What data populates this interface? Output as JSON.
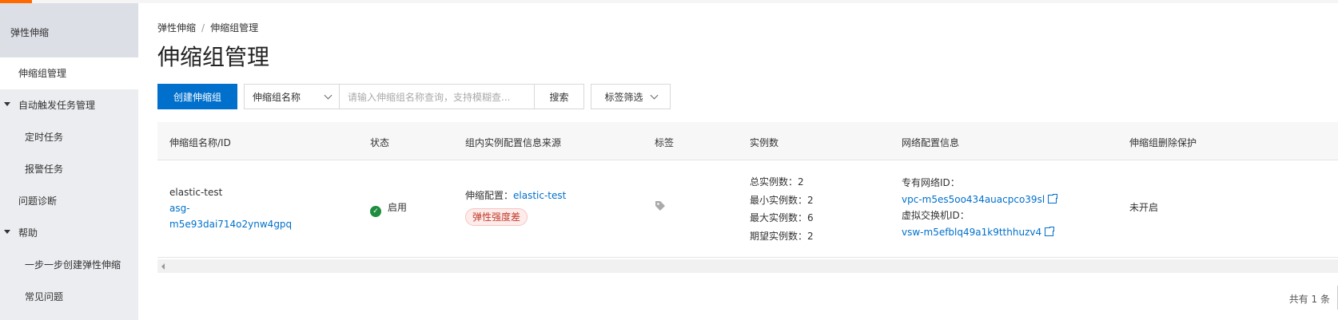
{
  "sidebar": {
    "title": "弹性伸缩",
    "items": [
      {
        "label": "伸缩组管理"
      },
      {
        "label": "自动触发任务管理"
      },
      {
        "label": "定时任务"
      },
      {
        "label": "报警任务"
      },
      {
        "label": "问题诊断"
      },
      {
        "label": "帮助"
      },
      {
        "label": "一步一步创建弹性伸缩"
      },
      {
        "label": "常见问题"
      }
    ]
  },
  "breadcrumb": {
    "root": "弹性伸缩",
    "separator": "/",
    "current": "伸缩组管理"
  },
  "page_title": "伸缩组管理",
  "toolbar": {
    "create_label": "创建伸缩组",
    "filter_select": "伸缩组名称",
    "search_placeholder": "请输入伸缩组名称查询，支持模糊查...",
    "search_label": "搜索",
    "tag_filter_label": "标签筛选"
  },
  "table": {
    "headers": [
      "伸缩组名称/ID",
      "状态",
      "组内实例配置信息来源",
      "标签",
      "实例数",
      "网络配置信息",
      "伸缩组删除保护"
    ],
    "rows": [
      {
        "name": "elastic-test",
        "id_line1": "asg-",
        "id_line2": "m5e93dai714o2ynw4gpq",
        "status": "启用",
        "config_label": "伸缩配置：",
        "config_value": "elastic-test",
        "badge": "弹性强度差",
        "counts": [
          "总实例数：2",
          "最小实例数：2",
          "最大实例数：6",
          "期望实例数：2"
        ],
        "vpc_label": "专有网络ID：",
        "vpc_id": "vpc-m5es5oo434auacpco39sl",
        "vsw_label": "虚拟交换机ID：",
        "vsw_id": "vsw-m5efblq49a1k9tthhuzv4",
        "protection": "未开启"
      }
    ]
  },
  "footer": {
    "total": "共有 1 条"
  },
  "icons": {
    "status": "check-circle-icon",
    "tag": "tag-icon",
    "external": "external-link-icon"
  },
  "colors": {
    "primary": "#0070cc",
    "success": "#1e8e3e",
    "badge_text": "#c23a2c",
    "accent": "#ff6a00"
  }
}
